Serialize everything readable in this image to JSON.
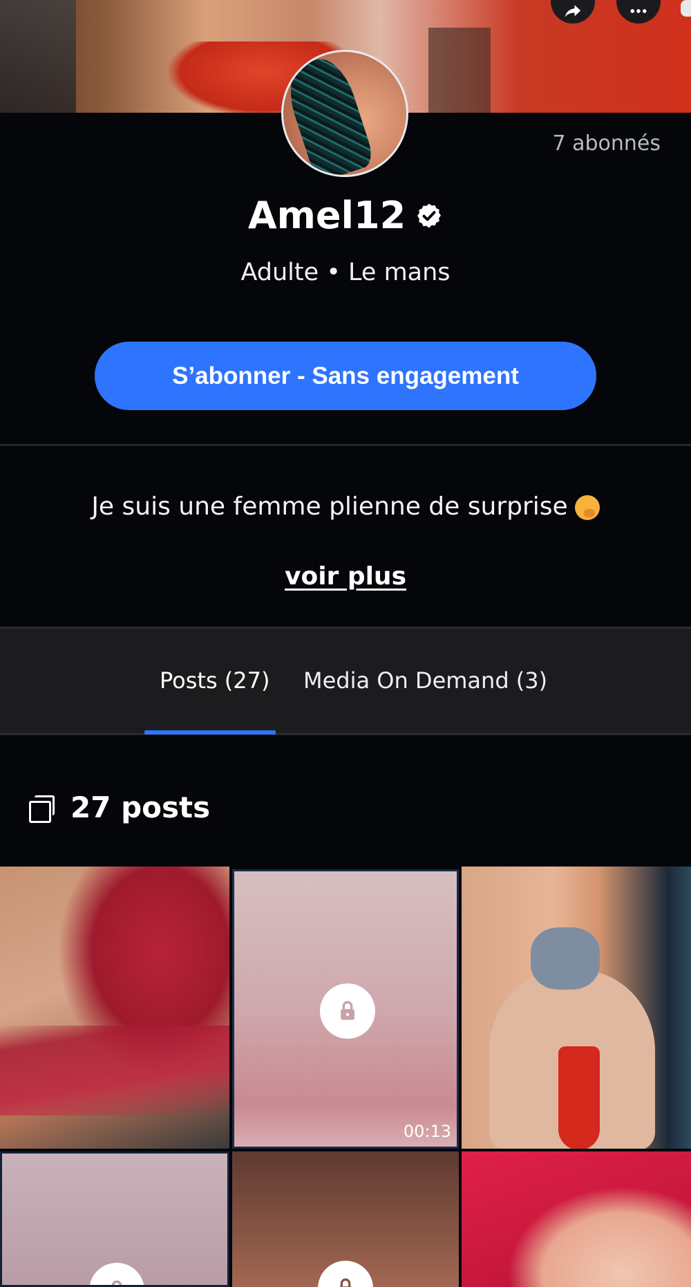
{
  "profile": {
    "followers_label": "7 abonnés",
    "name": "Amel12",
    "subtitle": "Adulte • Le mans",
    "subscribe_label": "S’abonner - Sans engagement",
    "bio": "Je suis une femme plienne de surprise",
    "see_more_label": "voir plus"
  },
  "header": {
    "share_icon": "share-icon",
    "more_icon": "more-horizontal-icon"
  },
  "tabs": [
    {
      "label": "Posts (27)",
      "active": true
    },
    {
      "label": "Media On Demand (3)",
      "active": false
    }
  ],
  "posts": {
    "count_label": "27 posts",
    "tiles": [
      {
        "locked": false
      },
      {
        "locked": true,
        "duration": "00:13"
      },
      {
        "locked": false
      },
      {
        "locked": true
      },
      {
        "locked": true
      },
      {
        "locked": false
      }
    ]
  },
  "colors": {
    "accent": "#2e74ff",
    "background": "#05060a",
    "tab_bar": "#1c1c1f"
  }
}
